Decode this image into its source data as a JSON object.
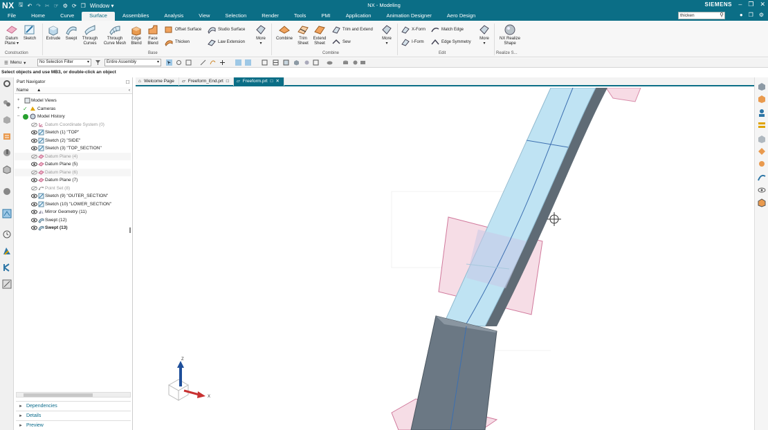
{
  "titlebar": {
    "logo": "NX",
    "window_menu": "Window",
    "title": "NX - Modeling",
    "brand": "SIEMENS"
  },
  "menu": {
    "tabs": [
      "File",
      "Home",
      "Curve",
      "Surface",
      "Assemblies",
      "Analysis",
      "View",
      "Selection",
      "Render",
      "Tools",
      "PMI",
      "Application",
      "Animation Designer",
      "Aero Design"
    ],
    "active": "Surface",
    "search_value": "thicken"
  },
  "ribbon": {
    "construction": {
      "datum_plane": "Datum Plane",
      "sketch": "Sketch",
      "label": "Construction"
    },
    "base": {
      "extrude": "Extrude",
      "swept": "Swept",
      "through_curves": "Through Curves",
      "through_curve_mesh": "Through Curve Mesh",
      "edge_blend": "Edge Blend",
      "face_blend": "Face Blend",
      "offset_surface": "Offset Surface",
      "thicken": "Thicken",
      "studio_surface": "Studio Surface",
      "law_extension": "Law Extension",
      "more": "More",
      "label": "Base"
    },
    "combine": {
      "combine": "Combine",
      "trim_sheet": "Trim Sheet",
      "extend_sheet": "Extend Sheet",
      "trim_and_extend": "Trim and Extend",
      "sew": "Sew",
      "more": "More",
      "label": "Combine"
    },
    "edit": {
      "xform": "X-Form",
      "iform": "I-Form",
      "match_edge": "Match Edge",
      "edge_symmetry": "Edge Symmetry",
      "more": "More",
      "label": "Edit"
    },
    "realize": {
      "nx_realize_shape": "NX Realize Shape",
      "label": "Realize S..."
    }
  },
  "selection_bar": {
    "menu": "Menu",
    "filter": "No Selection Filter",
    "scope": "Entire Assembly"
  },
  "status": "Select objects and use MB3, or double-click an object",
  "navigator": {
    "title": "Part Navigator",
    "column_name": "Name",
    "items": [
      {
        "label": "Model Views"
      },
      {
        "label": "Cameras"
      },
      {
        "label": "Model History"
      },
      {
        "label": "Datum Coordinate System (0)"
      },
      {
        "label": "Sketch (1) \"TOP\""
      },
      {
        "label": "Sketch (2) \"SIDE\""
      },
      {
        "label": "Sketch (3) \"TOP_SECTION\""
      },
      {
        "label": "Datum Plane (4)"
      },
      {
        "label": "Datum Plane (5)"
      },
      {
        "label": "Datum Plane (6)"
      },
      {
        "label": "Datum Plane (7)"
      },
      {
        "label": "Point Set (8)"
      },
      {
        "label": "Sketch (9) \"OUTER_SECTION\""
      },
      {
        "label": "Sketch (10) \"LOWER_SECTION\""
      },
      {
        "label": "Mirror Geometry (11)"
      },
      {
        "label": "Swept (12)"
      },
      {
        "label": "Swept (13)"
      }
    ],
    "panels": [
      "Dependencies",
      "Details",
      "Preview"
    ]
  },
  "doc_tabs": [
    {
      "label": "Welcome Page"
    },
    {
      "label": "Freeform_End.prt"
    },
    {
      "label": "Freeform.prt"
    }
  ],
  "triad": {
    "z": "Z",
    "x": "X"
  },
  "colors": {
    "brand": "#0b6e86",
    "surface": "#bfe3f3",
    "plane": "#e8a9c0",
    "solid": "#6b7884"
  }
}
